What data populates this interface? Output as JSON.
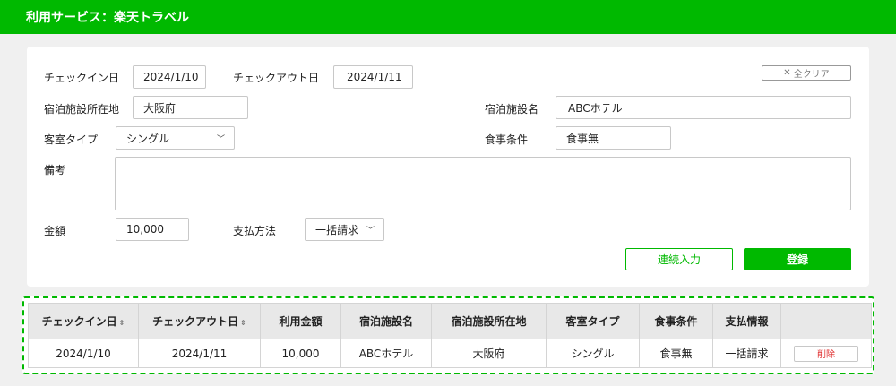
{
  "header": {
    "title": "利用サービス：楽天トラベル"
  },
  "form": {
    "checkin_label": "チェックイン日",
    "checkin_value": "2024/1/10",
    "checkout_label": "チェックアウト日",
    "checkout_value": "2024/1/11",
    "clear_label": "全クリア",
    "location_label": "宿泊施設所在地",
    "location_value": "大阪府",
    "facility_label": "宿泊施設名",
    "facility_value": "ABCホテル",
    "roomtype_label": "客室タイプ",
    "roomtype_value": "シングル",
    "meal_label": "食事条件",
    "meal_value": "食事無",
    "notes_label": "備考",
    "notes_value": "",
    "amount_label": "金額",
    "amount_value": "10,000",
    "payment_label": "支払方法",
    "payment_value": "一括請求",
    "continuous_label": "連続入力",
    "register_label": "登録"
  },
  "table": {
    "headers": [
      "チェックイン日",
      "チェックアウト日",
      "利用金額",
      "宿泊施設名",
      "宿泊施設所在地",
      "客室タイプ",
      "食事条件",
      "支払情報",
      ""
    ],
    "rows": [
      {
        "checkin": "2024/1/10",
        "checkout": "2024/1/11",
        "amount": "10,000",
        "facility": "ABCホテル",
        "location": "大阪府",
        "roomtype": "シングル",
        "meal": "食事無",
        "payment": "一括請求",
        "delete_label": "削除"
      }
    ]
  },
  "colors": {
    "accent": "#00b900",
    "danger": "#e03030"
  }
}
